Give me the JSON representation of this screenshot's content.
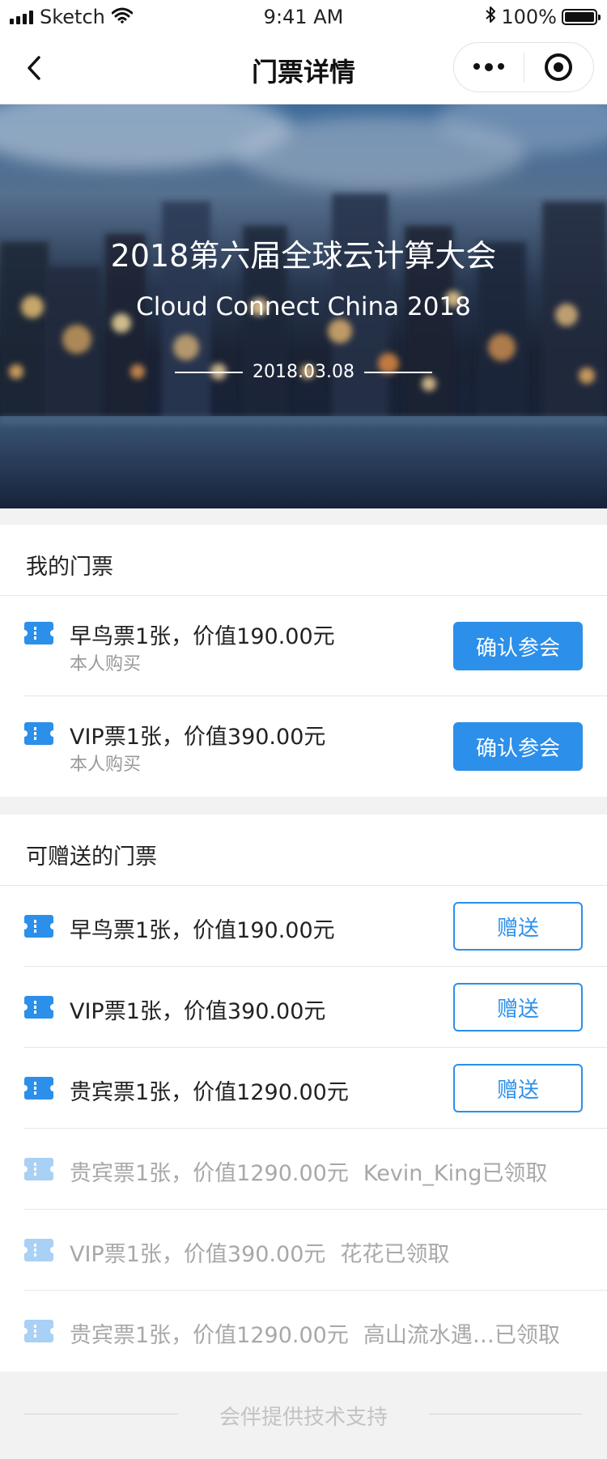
{
  "status_bar": {
    "carrier": "Sketch",
    "time": "9:41 AM",
    "battery": "100%"
  },
  "nav": {
    "title": "门票详情"
  },
  "hero": {
    "title": "2018第六届全球云计算大会",
    "subtitle": "Cloud Connect China 2018",
    "date": "2018.03.08"
  },
  "my_tickets": {
    "title": "我的门票",
    "items": [
      {
        "label": "早鸟票1张，价值190.00元",
        "sub": "本人购买",
        "action": "确认参会"
      },
      {
        "label": "VIP票1张，价值390.00元",
        "sub": "本人购买",
        "action": "确认参会"
      }
    ]
  },
  "giftable": {
    "title": "可赠送的门票",
    "items": [
      {
        "label": "早鸟票1张，价值190.00元",
        "action": "赠送"
      },
      {
        "label": "VIP票1张，价值390.00元",
        "action": "赠送"
      },
      {
        "label": "贵宾票1张，价值1290.00元",
        "action": "赠送"
      }
    ],
    "received": [
      {
        "label": "贵宾票1张，价值1290.00元",
        "status": "Kevin_King已领取"
      },
      {
        "label": "VIP票1张，价值390.00元",
        "status": "花花已领取"
      },
      {
        "label": "贵宾票1张，价值1290.00元",
        "status": "高山流水遇…已领取"
      }
    ]
  },
  "footer": {
    "text": "会伴提供技术支持"
  },
  "colors": {
    "accent": "#2c8fea",
    "icon_active": "#2c8fea",
    "icon_faded": "#a9d0f5"
  }
}
